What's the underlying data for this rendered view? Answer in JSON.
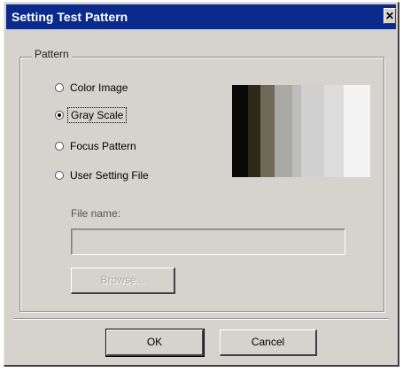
{
  "window": {
    "title": "Setting Test Pattern",
    "close_glyph": "✕"
  },
  "pattern_group": {
    "label": "Pattern",
    "options": [
      {
        "label": "Color Image",
        "selected": false
      },
      {
        "label": "Gray Scale",
        "selected": true
      },
      {
        "label": "Focus Pattern",
        "selected": false
      },
      {
        "label": "User Setting File",
        "selected": false
      }
    ],
    "preview_shades": [
      "#0a0a08",
      "#2e2a1a",
      "#6e6a58",
      "#a9a9a6",
      "#bdbdbd",
      "#d0d0d0",
      "#dcdcdc",
      "#f4f4f4"
    ]
  },
  "file": {
    "label": "File name:",
    "value": "",
    "browse_label": "Browse..."
  },
  "buttons": {
    "ok_label": "OK",
    "cancel_label": "Cancel"
  }
}
